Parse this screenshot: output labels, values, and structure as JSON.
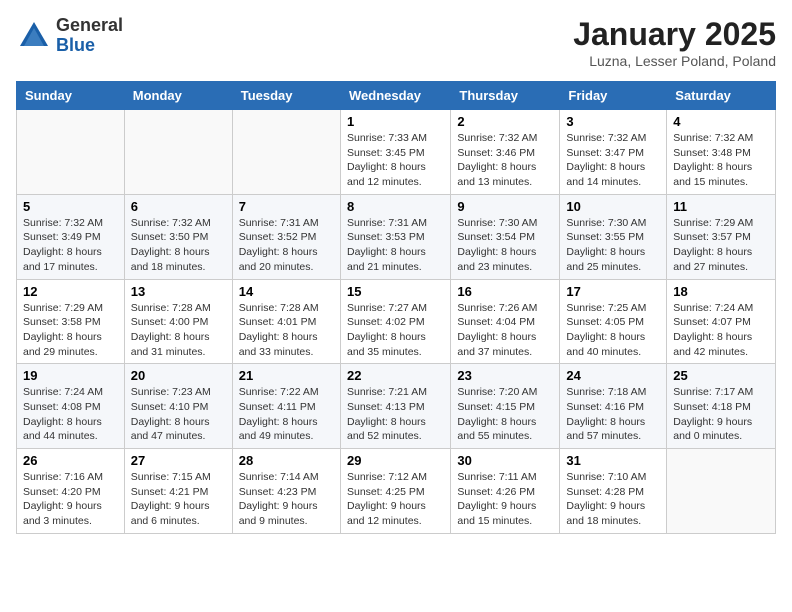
{
  "header": {
    "logo_general": "General",
    "logo_blue": "Blue",
    "month_title": "January 2025",
    "location": "Luzna, Lesser Poland, Poland"
  },
  "weekdays": [
    "Sunday",
    "Monday",
    "Tuesday",
    "Wednesday",
    "Thursday",
    "Friday",
    "Saturday"
  ],
  "weeks": [
    [
      {
        "day": "",
        "detail": ""
      },
      {
        "day": "",
        "detail": ""
      },
      {
        "day": "",
        "detail": ""
      },
      {
        "day": "1",
        "detail": "Sunrise: 7:33 AM\nSunset: 3:45 PM\nDaylight: 8 hours\nand 12 minutes."
      },
      {
        "day": "2",
        "detail": "Sunrise: 7:32 AM\nSunset: 3:46 PM\nDaylight: 8 hours\nand 13 minutes."
      },
      {
        "day": "3",
        "detail": "Sunrise: 7:32 AM\nSunset: 3:47 PM\nDaylight: 8 hours\nand 14 minutes."
      },
      {
        "day": "4",
        "detail": "Sunrise: 7:32 AM\nSunset: 3:48 PM\nDaylight: 8 hours\nand 15 minutes."
      }
    ],
    [
      {
        "day": "5",
        "detail": "Sunrise: 7:32 AM\nSunset: 3:49 PM\nDaylight: 8 hours\nand 17 minutes."
      },
      {
        "day": "6",
        "detail": "Sunrise: 7:32 AM\nSunset: 3:50 PM\nDaylight: 8 hours\nand 18 minutes."
      },
      {
        "day": "7",
        "detail": "Sunrise: 7:31 AM\nSunset: 3:52 PM\nDaylight: 8 hours\nand 20 minutes."
      },
      {
        "day": "8",
        "detail": "Sunrise: 7:31 AM\nSunset: 3:53 PM\nDaylight: 8 hours\nand 21 minutes."
      },
      {
        "day": "9",
        "detail": "Sunrise: 7:30 AM\nSunset: 3:54 PM\nDaylight: 8 hours\nand 23 minutes."
      },
      {
        "day": "10",
        "detail": "Sunrise: 7:30 AM\nSunset: 3:55 PM\nDaylight: 8 hours\nand 25 minutes."
      },
      {
        "day": "11",
        "detail": "Sunrise: 7:29 AM\nSunset: 3:57 PM\nDaylight: 8 hours\nand 27 minutes."
      }
    ],
    [
      {
        "day": "12",
        "detail": "Sunrise: 7:29 AM\nSunset: 3:58 PM\nDaylight: 8 hours\nand 29 minutes."
      },
      {
        "day": "13",
        "detail": "Sunrise: 7:28 AM\nSunset: 4:00 PM\nDaylight: 8 hours\nand 31 minutes."
      },
      {
        "day": "14",
        "detail": "Sunrise: 7:28 AM\nSunset: 4:01 PM\nDaylight: 8 hours\nand 33 minutes."
      },
      {
        "day": "15",
        "detail": "Sunrise: 7:27 AM\nSunset: 4:02 PM\nDaylight: 8 hours\nand 35 minutes."
      },
      {
        "day": "16",
        "detail": "Sunrise: 7:26 AM\nSunset: 4:04 PM\nDaylight: 8 hours\nand 37 minutes."
      },
      {
        "day": "17",
        "detail": "Sunrise: 7:25 AM\nSunset: 4:05 PM\nDaylight: 8 hours\nand 40 minutes."
      },
      {
        "day": "18",
        "detail": "Sunrise: 7:24 AM\nSunset: 4:07 PM\nDaylight: 8 hours\nand 42 minutes."
      }
    ],
    [
      {
        "day": "19",
        "detail": "Sunrise: 7:24 AM\nSunset: 4:08 PM\nDaylight: 8 hours\nand 44 minutes."
      },
      {
        "day": "20",
        "detail": "Sunrise: 7:23 AM\nSunset: 4:10 PM\nDaylight: 8 hours\nand 47 minutes."
      },
      {
        "day": "21",
        "detail": "Sunrise: 7:22 AM\nSunset: 4:11 PM\nDaylight: 8 hours\nand 49 minutes."
      },
      {
        "day": "22",
        "detail": "Sunrise: 7:21 AM\nSunset: 4:13 PM\nDaylight: 8 hours\nand 52 minutes."
      },
      {
        "day": "23",
        "detail": "Sunrise: 7:20 AM\nSunset: 4:15 PM\nDaylight: 8 hours\nand 55 minutes."
      },
      {
        "day": "24",
        "detail": "Sunrise: 7:18 AM\nSunset: 4:16 PM\nDaylight: 8 hours\nand 57 minutes."
      },
      {
        "day": "25",
        "detail": "Sunrise: 7:17 AM\nSunset: 4:18 PM\nDaylight: 9 hours\nand 0 minutes."
      }
    ],
    [
      {
        "day": "26",
        "detail": "Sunrise: 7:16 AM\nSunset: 4:20 PM\nDaylight: 9 hours\nand 3 minutes."
      },
      {
        "day": "27",
        "detail": "Sunrise: 7:15 AM\nSunset: 4:21 PM\nDaylight: 9 hours\nand 6 minutes."
      },
      {
        "day": "28",
        "detail": "Sunrise: 7:14 AM\nSunset: 4:23 PM\nDaylight: 9 hours\nand 9 minutes."
      },
      {
        "day": "29",
        "detail": "Sunrise: 7:12 AM\nSunset: 4:25 PM\nDaylight: 9 hours\nand 12 minutes."
      },
      {
        "day": "30",
        "detail": "Sunrise: 7:11 AM\nSunset: 4:26 PM\nDaylight: 9 hours\nand 15 minutes."
      },
      {
        "day": "31",
        "detail": "Sunrise: 7:10 AM\nSunset: 4:28 PM\nDaylight: 9 hours\nand 18 minutes."
      },
      {
        "day": "",
        "detail": ""
      }
    ]
  ]
}
